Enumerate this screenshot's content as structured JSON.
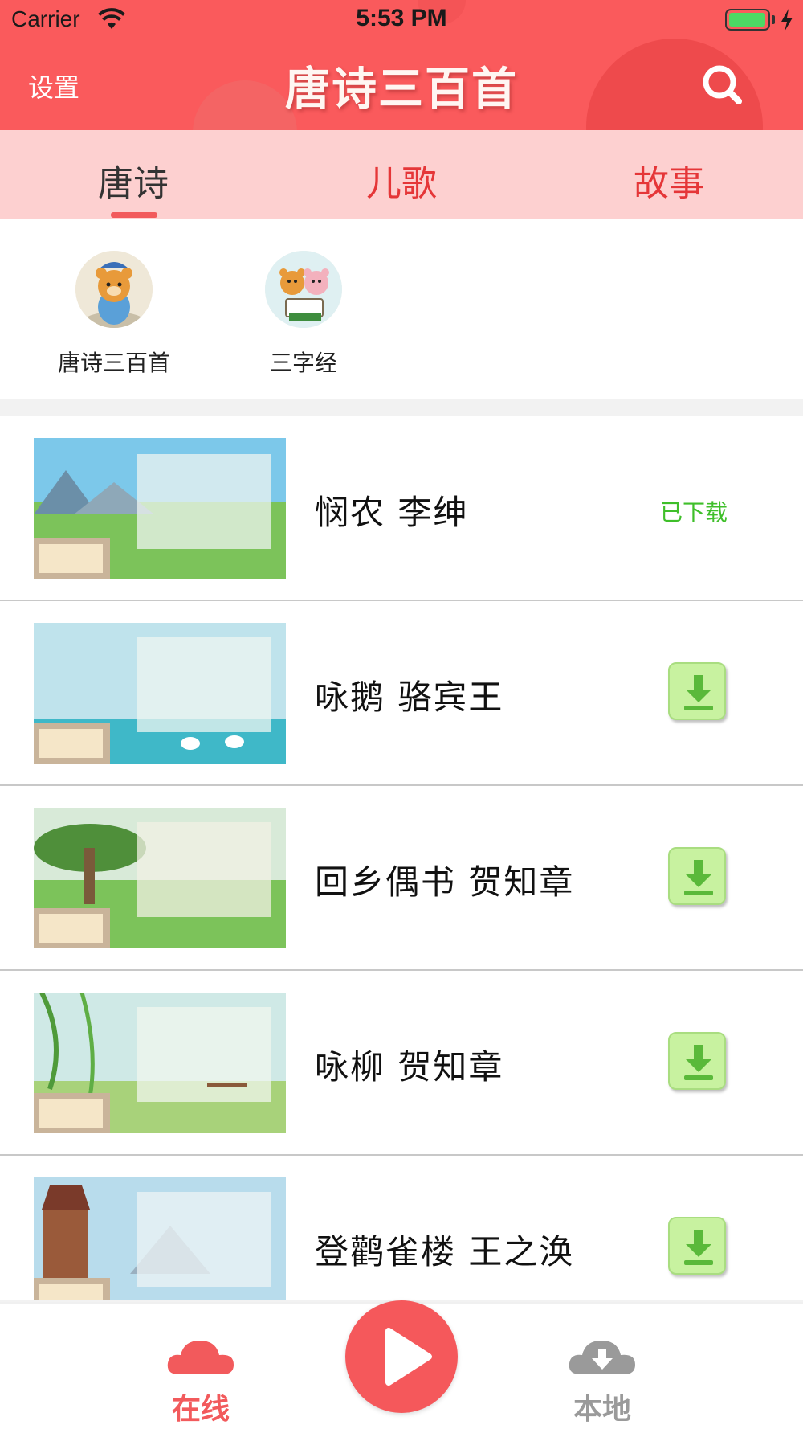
{
  "status_bar": {
    "carrier": "Carrier",
    "time": "5:53 PM"
  },
  "header": {
    "settings_label": "设置",
    "title": "唐诗三百首"
  },
  "tabs": [
    {
      "label": "唐诗",
      "active": true
    },
    {
      "label": "儿歌",
      "active": false
    },
    {
      "label": "故事",
      "active": false
    }
  ],
  "categories": [
    {
      "label": "唐诗三百首",
      "icon": "bear-scholar-avatar"
    },
    {
      "label": "三字经",
      "icon": "bears-reading-avatar"
    }
  ],
  "poems": [
    {
      "title": "悯农 李绅",
      "status": "已下载"
    },
    {
      "title": "咏鹅 骆宾王",
      "status": "download"
    },
    {
      "title": "回乡偶书 贺知章",
      "status": "download"
    },
    {
      "title": "咏柳 贺知章",
      "status": "download"
    },
    {
      "title": "登鹳雀楼 王之涣",
      "status": "download"
    }
  ],
  "bottom_nav": {
    "online_label": "在线",
    "local_label": "本地"
  },
  "colors": {
    "header": "#fa5a5c",
    "tab_bar": "#fdd0d0",
    "accent": "#f25a5c",
    "downloaded_text": "#3fbf2a",
    "download_button": "#c8f2a0"
  }
}
